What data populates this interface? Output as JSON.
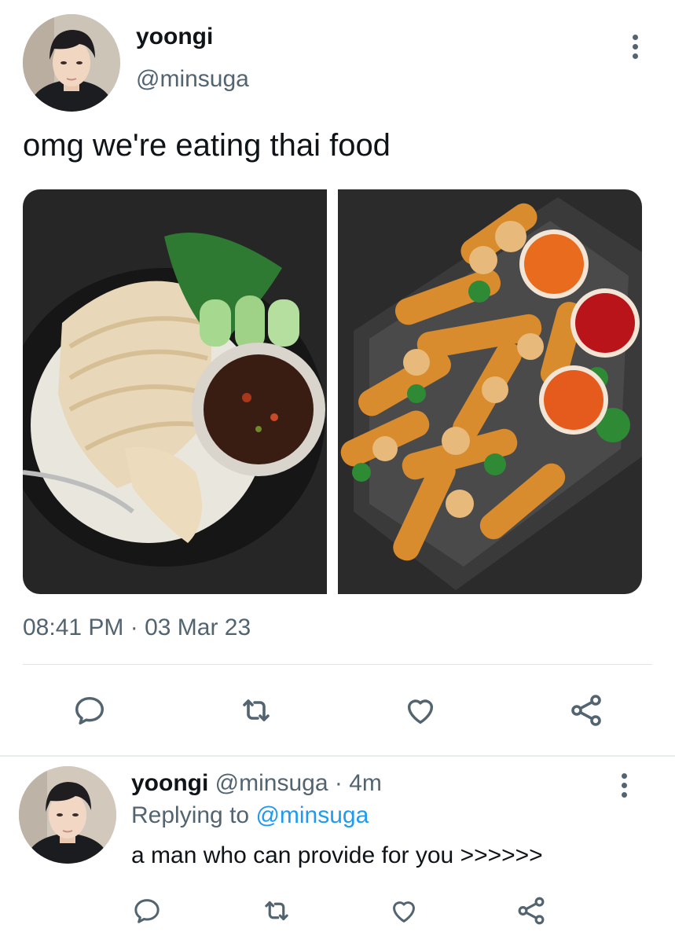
{
  "tweet": {
    "author_name": "yoongi",
    "author_handle": "@minsuga",
    "text": "omg we're eating thai food",
    "timestamp": "08:41 PM · 03 Mar 23",
    "media": [
      "thai chicken rice with dipping sauce",
      "spring rolls with dipping sauces"
    ]
  },
  "actions": [
    "reply-icon",
    "retweet-icon",
    "like-icon",
    "share-icon"
  ],
  "reply": {
    "author_name": "yoongi",
    "author_handle": "@minsuga",
    "separator": "·",
    "time": "4m",
    "replying_prefix": "Replying to",
    "replying_handle": "@minsuga",
    "text": "a man who can provide for you >>>>>>"
  },
  "colors": {
    "text": "#0f1419",
    "secondary": "#536471",
    "link": "#1d9bf0",
    "divider": "#e1e8ed"
  }
}
